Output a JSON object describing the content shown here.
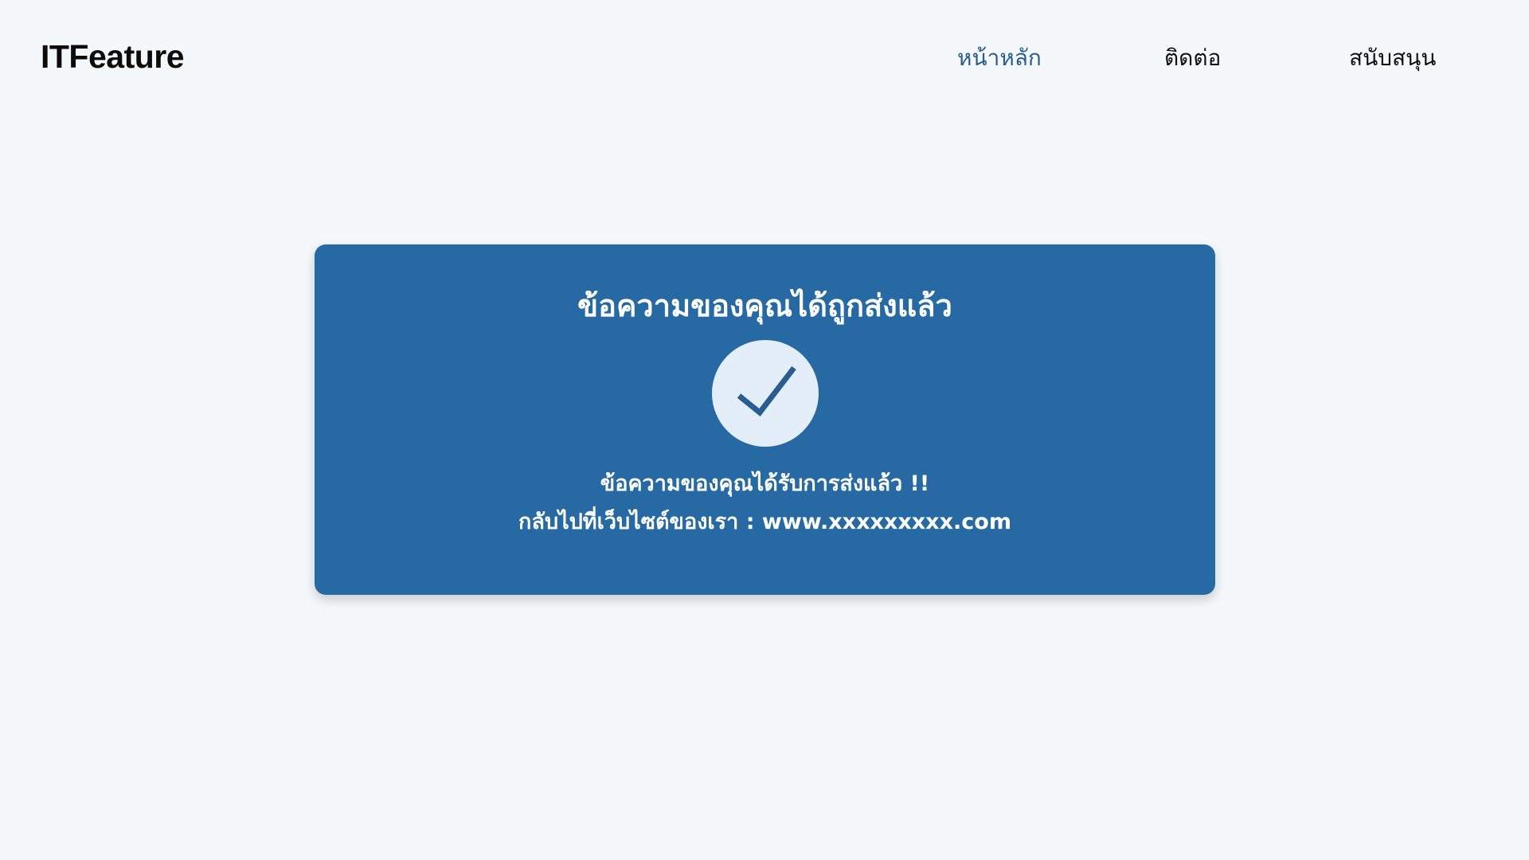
{
  "header": {
    "logo": "ITFeature",
    "nav": {
      "home": "หน้าหลัก",
      "contact": "ติดต่อ",
      "support": "สนับสนุน"
    }
  },
  "card": {
    "title": "ข้อความของคุณได้ถูกส่งแล้ว",
    "icon": "check-icon",
    "message": "ข้อความของคุณได้รับการส่งแล้ว !!",
    "back_link": "กลับไปที่เว็บไซต์ของเรา : www.xxxxxxxxx.com"
  },
  "colors": {
    "page_background": "#f4f8fb",
    "card_background": "#2669a3",
    "nav_active": "#2a5d8f",
    "icon_circle": "#e3eef8",
    "check_mark": "#2a5d8f"
  }
}
